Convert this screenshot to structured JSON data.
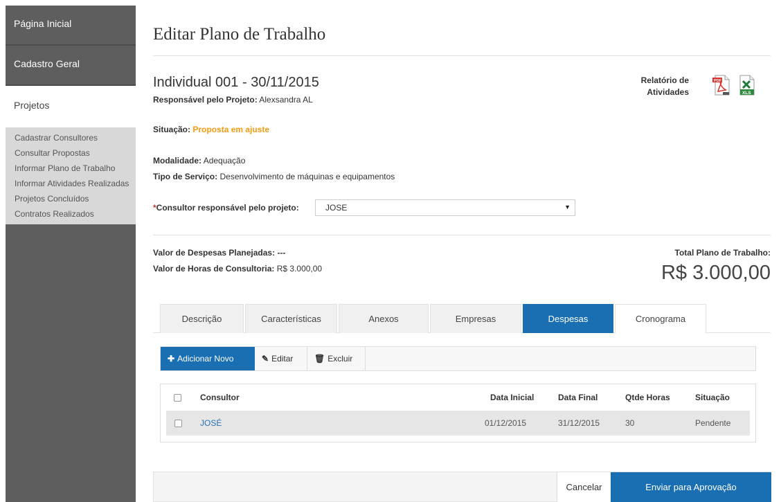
{
  "sidebar": {
    "main_items": [
      "Página Inicial",
      "Cadastro Geral",
      "Projetos"
    ],
    "sub_items": [
      "Cadastrar Consultores",
      "Consultar Propostas",
      "Informar Plano de Trabalho",
      "Informar Atividades Realizadas",
      "Projetos Concluídos",
      "Contratos Realizados"
    ]
  },
  "page": {
    "title": "Editar Plano de Trabalho",
    "project_name": "Individual 001 - 30/11/2015",
    "responsavel_label": "Responsável pelo Projeto:",
    "responsavel_value": "Alexsandra AL",
    "situacao_label": "Situação:",
    "situacao_value": "Proposta em ajuste",
    "modalidade_label": "Modalidade:",
    "modalidade_value": "Adequação",
    "tipo_label": "Tipo de Serviço:",
    "tipo_value": "Desenvolvimento de máquinas e equipamentos",
    "report_line1": "Relatório de",
    "report_line2": "Atividades",
    "consultor_req": "*",
    "consultor_label": "Consultor responsável pelo projeto:",
    "consultor_selected": "JOSE",
    "despesas_label": "Valor de Despesas Planejadas:",
    "despesas_value": "---",
    "horas_label": "Valor de Horas de Consultoria:",
    "horas_value": "R$ 3.000,00",
    "total_label": "Total Plano de Trabalho:",
    "total_value": "R$ 3.000,00"
  },
  "tabs": [
    "Descrição",
    "Características",
    "Anexos",
    "Empresas",
    "Despesas",
    "Cronograma"
  ],
  "active_tab": "Despesas",
  "toolbar": {
    "add_label": "Adicionar Novo",
    "edit_label": "Editar",
    "delete_label": "Excluir"
  },
  "table": {
    "headers": [
      "Consultor",
      "Data Inicial",
      "Data Final",
      "Qtde Horas",
      "Situação"
    ],
    "rows": [
      {
        "consultor": "JOSÉ",
        "data_inicial": "01/12/2015",
        "data_final": "31/12/2015",
        "qtde_horas": "30",
        "situacao": "Pendente"
      }
    ]
  },
  "footer": {
    "cancel_label": "Cancelar",
    "send_label": "Enviar para Aprovação"
  },
  "icons": {
    "pdf": "pdf-file-icon",
    "xls": "excel-file-icon",
    "add": "plus-icon",
    "edit": "pencil-icon",
    "delete": "trash-icon",
    "caret": "caret-down-icon"
  },
  "colors": {
    "sidebar_bg": "#5e5e5e",
    "primary": "#1a6fb3",
    "status_orange": "#f39c12"
  }
}
